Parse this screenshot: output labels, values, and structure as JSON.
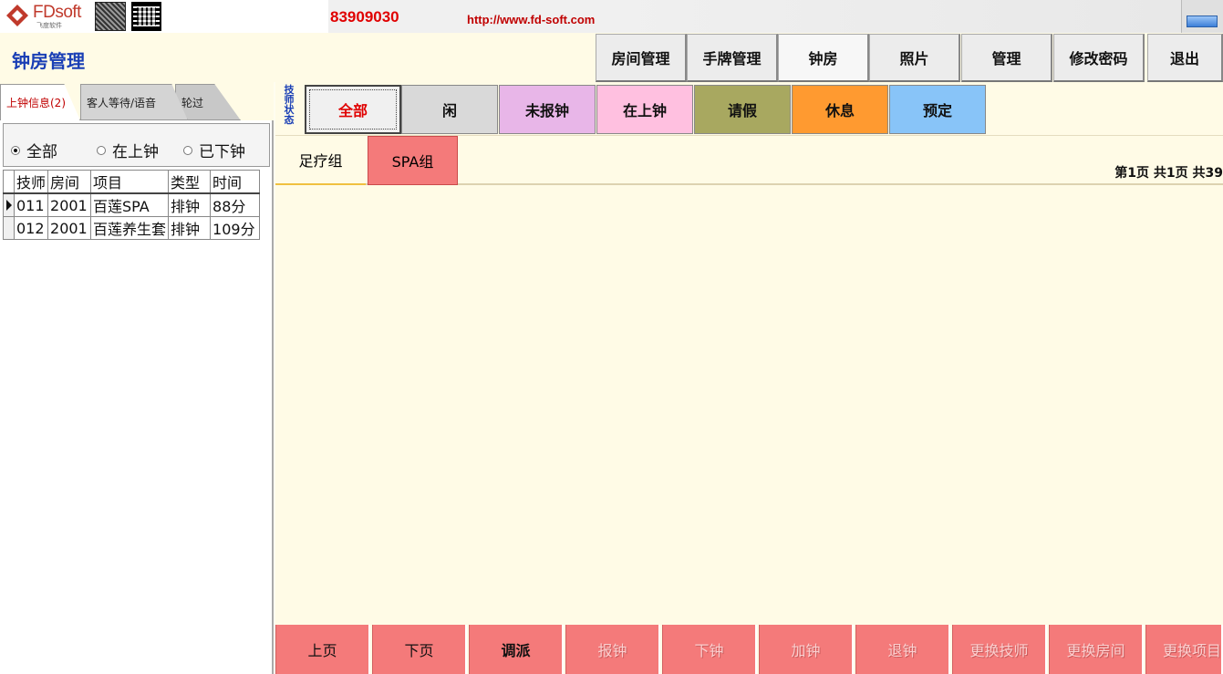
{
  "banner": {
    "logo_text": "FDsoft",
    "logo_sub": "飞度软件",
    "phone": "83909030",
    "url": "http://www.fd-soft.com"
  },
  "header": {
    "title": "钟房管理",
    "nav": [
      {
        "label": "房间管理"
      },
      {
        "label": "手牌管理"
      },
      {
        "label": "钟房"
      },
      {
        "label": "照片"
      },
      {
        "label": "管理"
      },
      {
        "label": "修改密码"
      },
      {
        "label": "退出"
      }
    ]
  },
  "left": {
    "tabs": [
      {
        "label": "上钟信息(2)"
      },
      {
        "label": "客人等待/语音"
      },
      {
        "label": "轮过"
      }
    ],
    "filters": [
      {
        "label": "全部",
        "checked": true
      },
      {
        "label": "在上钟",
        "checked": false
      },
      {
        "label": "已下钟",
        "checked": false
      }
    ],
    "columns": [
      "技师",
      "房间",
      "项目",
      "类型",
      "时间"
    ],
    "rows": [
      [
        "011",
        "2001",
        "百莲SPA",
        "排钟",
        "88分"
      ],
      [
        "012",
        "2001",
        "百莲养生套",
        "排钟",
        "109分"
      ]
    ]
  },
  "main": {
    "status_label": "技师状态",
    "status_buttons": [
      {
        "label": "全部",
        "color": "#f0f0f0"
      },
      {
        "label": "闲",
        "color": "#d9d9d9"
      },
      {
        "label": "未报钟",
        "color": "#e8b6e8"
      },
      {
        "label": "在上钟",
        "color": "#ffc0e0"
      },
      {
        "label": "请假",
        "color": "#a8a860"
      },
      {
        "label": "休息",
        "color": "#ff9a30"
      },
      {
        "label": "预定",
        "color": "#88c4f8"
      }
    ],
    "groups": [
      {
        "label": "足疗组"
      },
      {
        "label": "SPA组"
      }
    ],
    "page_info": "第1页 共1页 共39",
    "bottom_buttons": [
      {
        "label": "上页",
        "enabled": true
      },
      {
        "label": "下页",
        "enabled": true
      },
      {
        "label": "调派",
        "enabled": true
      },
      {
        "label": "报钟",
        "enabled": false
      },
      {
        "label": "下钟",
        "enabled": false
      },
      {
        "label": "加钟",
        "enabled": false
      },
      {
        "label": "退钟",
        "enabled": false
      },
      {
        "label": "更换技师",
        "enabled": false
      },
      {
        "label": "更换房间",
        "enabled": false
      },
      {
        "label": "更换项目",
        "enabled": false
      }
    ]
  }
}
